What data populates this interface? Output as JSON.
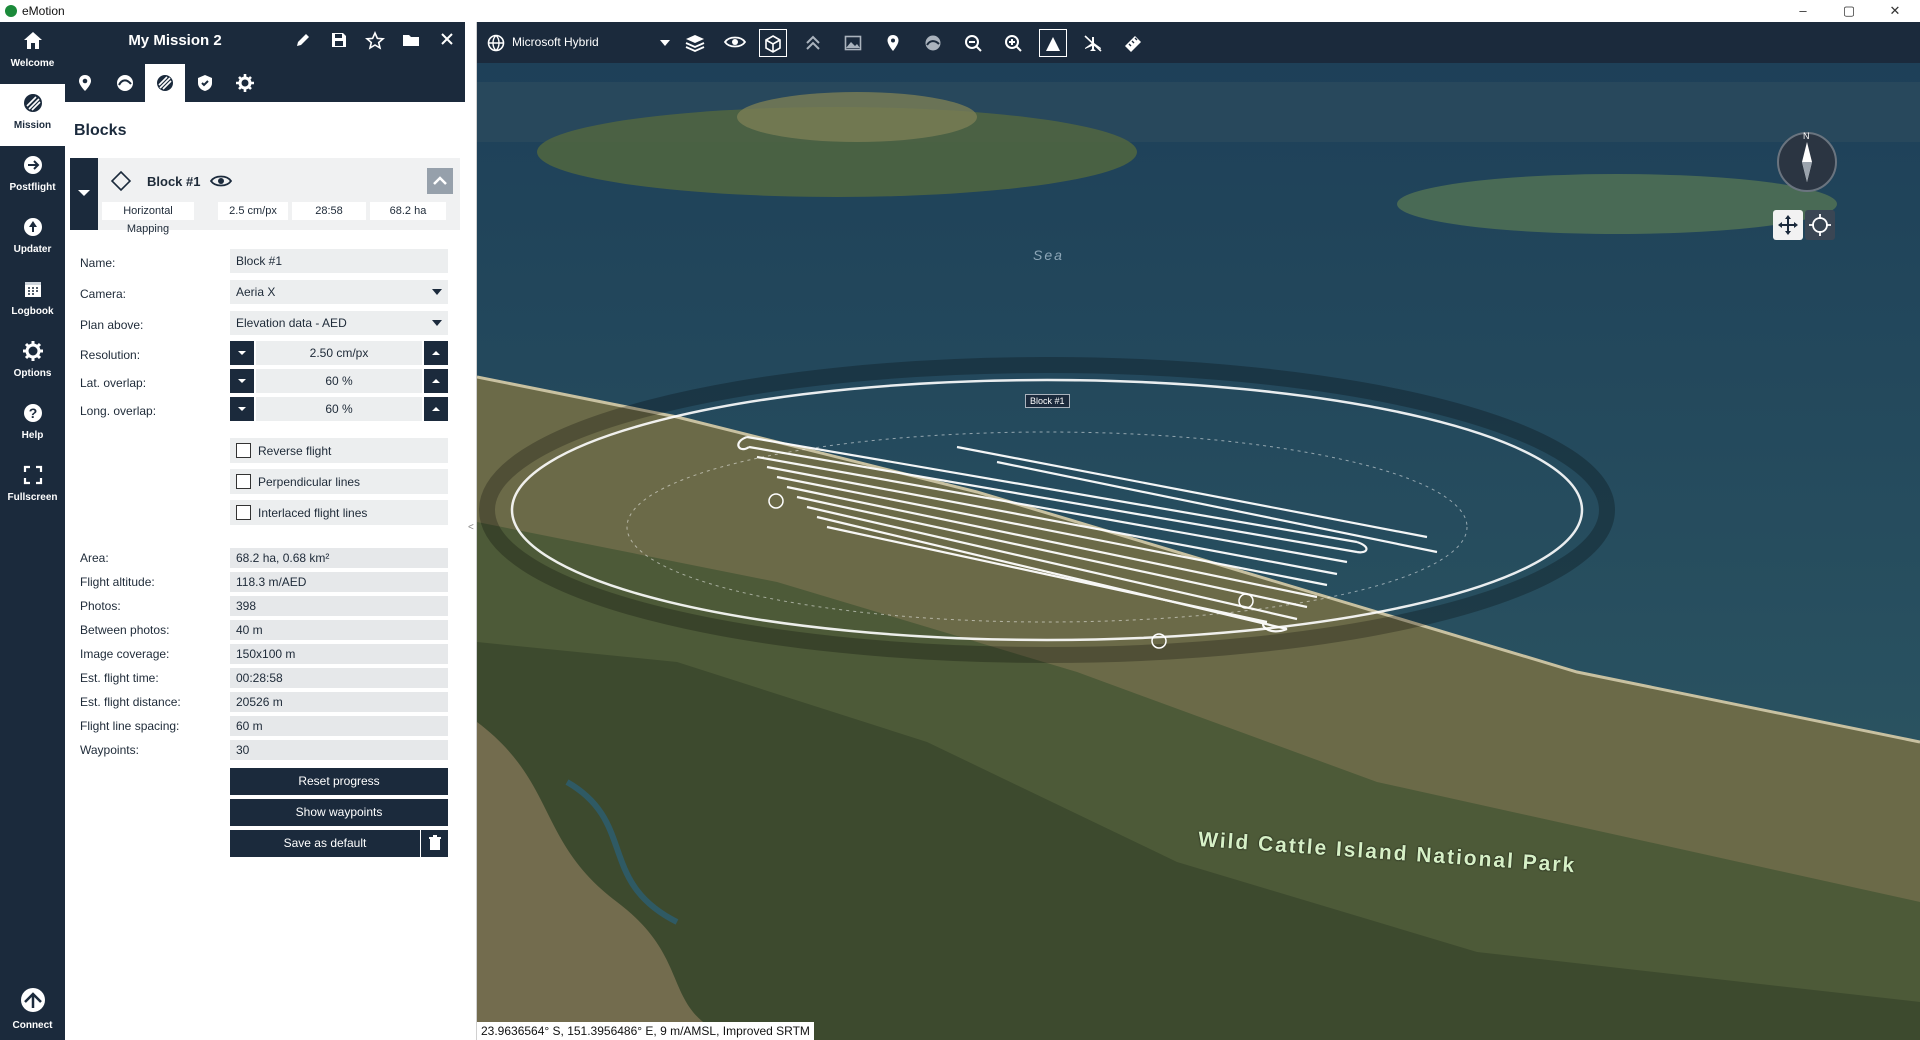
{
  "window": {
    "title": "eMotion",
    "controls": [
      "–",
      "▢",
      "✕"
    ]
  },
  "rail": {
    "items": [
      {
        "label": "Welcome",
        "icon": "home-icon"
      },
      {
        "label": "Mission",
        "icon": "mission-icon"
      },
      {
        "label": "Postflight",
        "icon": "postflight-icon"
      },
      {
        "label": "Updater",
        "icon": "updater-icon"
      },
      {
        "label": "Logbook",
        "icon": "calendar-icon"
      },
      {
        "label": "Options",
        "icon": "gear-icon"
      },
      {
        "label": "Help",
        "icon": "help-icon"
      },
      {
        "label": "Fullscreen",
        "icon": "fullscreen-icon"
      }
    ],
    "connect": "Connect"
  },
  "mission": {
    "title": "My Mission 2"
  },
  "blocks": {
    "section_title": "Blocks",
    "block": {
      "name": "Block #1",
      "type": "Horizontal Mapping",
      "resolution": "2.5 cm/px",
      "time": "28:58",
      "area": "68.2 ha"
    }
  },
  "form": {
    "name_label": "Name:",
    "name_value": "Block #1",
    "camera_label": "Camera:",
    "camera_value": "Aeria X",
    "plan_label": "Plan above:",
    "plan_value": "Elevation data - AED",
    "resolution_label": "Resolution:",
    "resolution_value": "2.50 cm/px",
    "lat_label": "Lat. overlap:",
    "lat_value": "60 %",
    "long_label": "Long. overlap:",
    "long_value": "60 %",
    "reverse": "Reverse flight",
    "perpendicular": "Perpendicular lines",
    "interlaced": "Interlaced flight lines"
  },
  "stats": [
    {
      "label": "Area:",
      "value": "68.2 ha, 0.68 km²"
    },
    {
      "label": "Flight altitude:",
      "value": "118.3 m/AED"
    },
    {
      "label": "Photos:",
      "value": "398"
    },
    {
      "label": "Between photos:",
      "value": "40 m"
    },
    {
      "label": "Image coverage:",
      "value": "150x100 m"
    },
    {
      "label": "Est. flight time:",
      "value": "00:28:58"
    },
    {
      "label": "Est. flight distance:",
      "value": "20526 m"
    },
    {
      "label": "Flight line spacing:",
      "value": "60 m"
    },
    {
      "label": "Waypoints:",
      "value": "30"
    }
  ],
  "buttons": {
    "reset": "Reset progress",
    "show_waypoints": "Show waypoints",
    "save_default": "Save as default"
  },
  "map": {
    "basemap": "Microsoft Hybrid",
    "sea_label": "Sea",
    "park_label": "Wild Cattle Island National Park",
    "block_tag": "Block #1",
    "compass": "N",
    "status": "23.9636564° S, 151.3956486° E, 9 m/AMSL, Improved SRTM"
  },
  "colors": {
    "navy": "#1b2a3c",
    "field": "#eceeef",
    "accent_green": "#1b8a3a"
  }
}
